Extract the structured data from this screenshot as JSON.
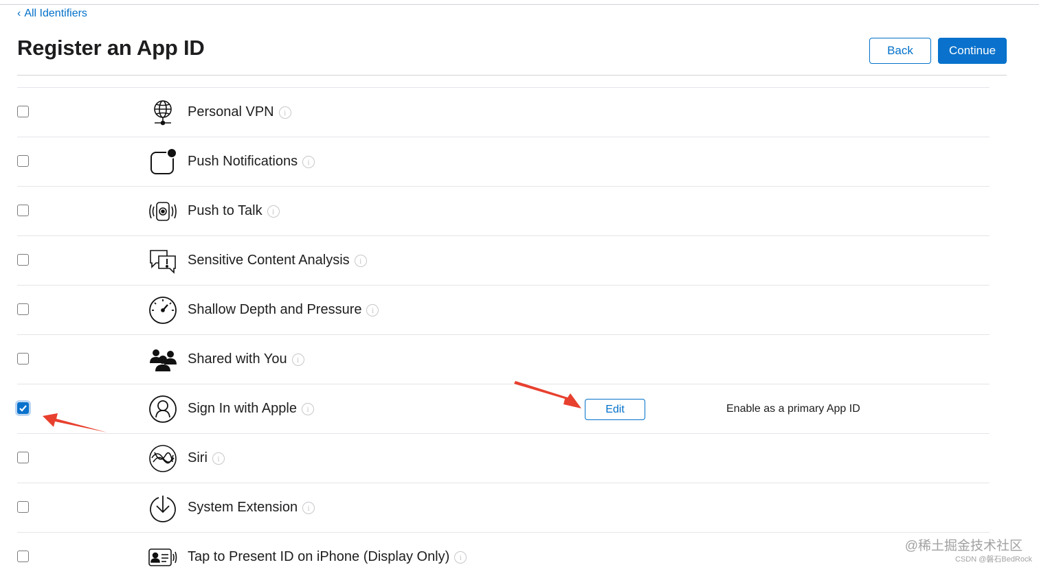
{
  "breadcrumb": {
    "chevron": "‹",
    "label": "All Identifiers"
  },
  "page_title": "Register an App ID",
  "buttons": {
    "back": "Back",
    "continue": "Continue"
  },
  "capabilities": [
    {
      "name": "Personal VPN",
      "icon": "globe-network-icon",
      "checked": false
    },
    {
      "name": "Push Notifications",
      "icon": "push-notification-icon",
      "checked": false
    },
    {
      "name": "Push to Talk",
      "icon": "walkie-talkie-icon",
      "checked": false
    },
    {
      "name": "Sensitive Content Analysis",
      "icon": "chat-bubbles-warning-icon",
      "checked": false
    },
    {
      "name": "Shallow Depth and Pressure",
      "icon": "depth-gauge-icon",
      "checked": false
    },
    {
      "name": "Shared with You",
      "icon": "people-group-icon",
      "checked": false
    },
    {
      "name": "Sign In with Apple",
      "icon": "person-circle-icon",
      "checked": true,
      "edit_label": "Edit",
      "note": "Enable as a primary App ID"
    },
    {
      "name": "Siri",
      "icon": "siri-icon",
      "checked": false
    },
    {
      "name": "System Extension",
      "icon": "download-circle-icon",
      "checked": false
    },
    {
      "name": "Tap to Present ID on iPhone (Display Only)",
      "icon": "id-card-icon",
      "checked": false
    }
  ],
  "info_glyph": "i",
  "annotation_color": "#e8402f",
  "accent_color": "#0070c9",
  "watermark": {
    "main": "@稀土掘金技术社区",
    "small": "CSDN @磐石BedRock"
  }
}
